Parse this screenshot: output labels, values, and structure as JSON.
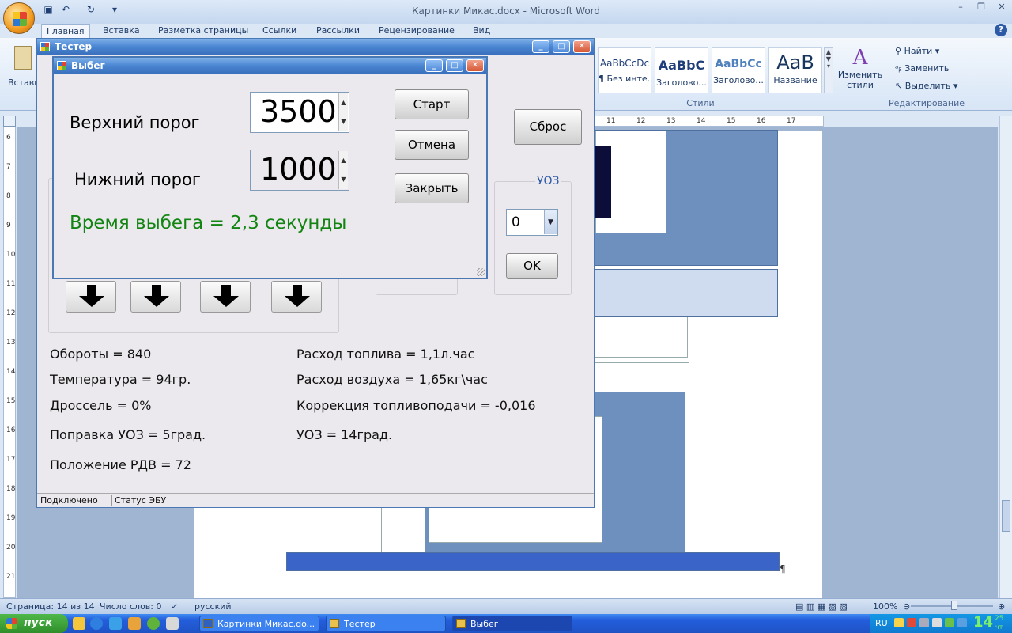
{
  "word": {
    "title": "Картинки Микас.docx - Microsoft Word",
    "tabs": [
      "Главная",
      "Вставка",
      "Разметка страницы",
      "Ссылки",
      "Рассылки",
      "Рецензирование",
      "Вид"
    ],
    "paste_label": "Вставить",
    "styles": [
      {
        "sample": "AaBbCcDc",
        "label": "¶ Без инте..."
      },
      {
        "sample": "AaBbC",
        "label": "Заголово..."
      },
      {
        "sample": "AaBbCc",
        "label": "Заголово..."
      },
      {
        "sample": "AaB",
        "label": "Название"
      }
    ],
    "change_styles": "Изменить стили",
    "styles_group": "Стили",
    "edit": {
      "find": "Найти",
      "replace": "Заменить",
      "select": "Выделить",
      "group": "Редактирование"
    },
    "ruler_numbers": [
      "11",
      "12",
      "13",
      "14",
      "15",
      "16",
      "17"
    ],
    "vruler_numbers": [
      "6",
      "7",
      "8",
      "9",
      "10",
      "11",
      "12",
      "13",
      "14",
      "15",
      "16",
      "17",
      "18",
      "19",
      "20",
      "21"
    ],
    "status": {
      "page": "Страница: 14 из 14",
      "words": "Число слов: 0",
      "lang": "русский",
      "zoom": "100%"
    }
  },
  "tester": {
    "title": "Тестер",
    "reset_button": "Сброс",
    "uoz_group": "УОЗ",
    "uoz_value": "0",
    "ok_button": "OK",
    "info_left": [
      "Обороты = 840",
      "Температура = 94гр.",
      "Дроссель = 0%",
      "Поправка УОЗ = 5град.",
      "Положение РДВ = 72"
    ],
    "info_right": [
      "Расход топлива = 1,1л.час",
      "Расход воздуха = 1,65кг\\час",
      "Коррекция топливоподачи = -0,016",
      "УОЗ = 14град."
    ],
    "status_left": "Подключено",
    "status_right": "Статус ЭБУ"
  },
  "vybeg": {
    "title": "Выбег",
    "upper_label": "Верхний порог",
    "upper_value": "3500",
    "lower_label": "Нижний порог",
    "lower_value": "1000",
    "start_button": "Старт",
    "cancel_button": "Отмена",
    "close_button": "Закрыть",
    "result": "Время выбега = 2,3 секунды",
    "result_color": "#118411"
  },
  "taskbar": {
    "start": "пуск",
    "tasks": [
      "Картинки Микас.do...",
      "Тестер",
      "Выбег"
    ],
    "lang": "RU",
    "clock_hour": "14",
    "clock_min": "25",
    "clock_day": "чт"
  }
}
